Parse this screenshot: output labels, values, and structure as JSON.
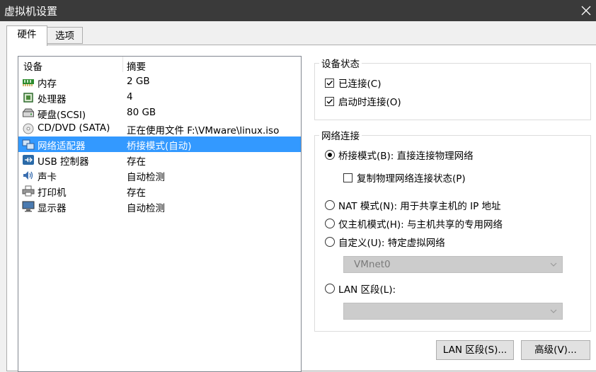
{
  "window": {
    "title": "虚拟机设置"
  },
  "tabs": [
    {
      "label": "硬件"
    },
    {
      "label": "选项"
    }
  ],
  "device_list": {
    "headers": {
      "device": "设备",
      "summary": "摘要"
    },
    "rows": [
      {
        "name": "内存",
        "summary": "2 GB",
        "icon": "memory-icon"
      },
      {
        "name": "处理器",
        "summary": "4",
        "icon": "processor-icon"
      },
      {
        "name": "硬盘(SCSI)",
        "summary": "80 GB",
        "icon": "hard-disk-icon"
      },
      {
        "name": "CD/DVD (SATA)",
        "summary": "正在使用文件 F:\\VMware\\linux.iso",
        "icon": "cd-dvd-icon"
      },
      {
        "name": "网络适配器",
        "summary": "桥接模式(自动)",
        "icon": "network-adapter-icon",
        "selected": true
      },
      {
        "name": "USB 控制器",
        "summary": "存在",
        "icon": "usb-icon"
      },
      {
        "name": "声卡",
        "summary": "自动检测",
        "icon": "sound-card-icon"
      },
      {
        "name": "打印机",
        "summary": "存在",
        "icon": "printer-icon"
      },
      {
        "name": "显示器",
        "summary": "自动检测",
        "icon": "display-icon"
      }
    ]
  },
  "device_status": {
    "legend": "设备状态",
    "connected": {
      "label": "已连接(C)",
      "checked": true
    },
    "connect_at_power_on": {
      "label": "启动时连接(O)",
      "checked": true
    }
  },
  "network": {
    "legend": "网络连接",
    "bridged": {
      "label": "桥接模式(B): 直接连接物理网络",
      "selected": true
    },
    "replicate": {
      "label": "复制物理网络连接状态(P)",
      "checked": false
    },
    "nat": {
      "label": "NAT 模式(N): 用于共享主机的 IP 地址",
      "selected": false
    },
    "host_only": {
      "label": "仅主机模式(H): 与主机共享的专用网络",
      "selected": false
    },
    "custom": {
      "label": "自定义(U): 特定虚拟网络",
      "selected": false
    },
    "custom_value": "VMnet0",
    "lan_segment": {
      "label": "LAN 区段(L):",
      "selected": false
    },
    "lan_value": ""
  },
  "buttons": {
    "lan_segments": "LAN 区段(S)...",
    "advanced": "高级(V)..."
  },
  "colors": {
    "selection": "#3399ff",
    "titlebar": "#3a3a3a"
  }
}
